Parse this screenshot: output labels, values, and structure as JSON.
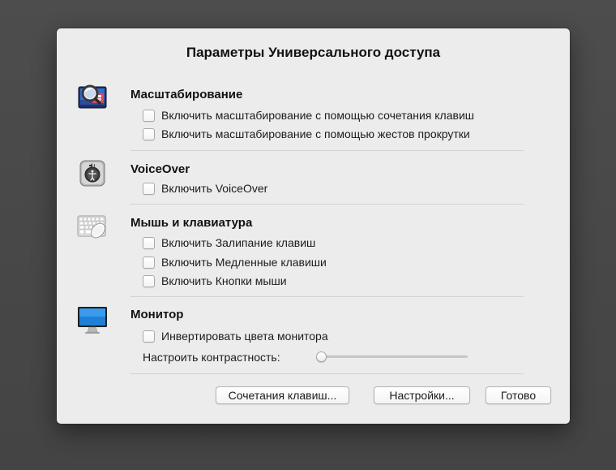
{
  "dialog": {
    "title": "Параметры Универсального доступа"
  },
  "sections": {
    "zoom": {
      "title": "Масштабирование",
      "icon": "zoom-magnifier-icon",
      "options": [
        "Включить масштабирование с помощью сочетания клавиш",
        "Включить масштабирование с помощью жестов прокрутки"
      ]
    },
    "voiceover": {
      "title": "VoiceOver",
      "icon": "voiceover-speaker-icon",
      "options": [
        "Включить VoiceOver"
      ]
    },
    "mouse_keyboard": {
      "title": "Мышь и клавиатура",
      "icon": "keyboard-mouse-icon",
      "options": [
        "Включить Залипание клавиш",
        "Включить Медленные клавиши",
        "Включить Кнопки мыши"
      ]
    },
    "monitor": {
      "title": "Монитор",
      "icon": "monitor-icon",
      "options": [
        "Инвертировать цвета монитора"
      ],
      "contrast_label": "Настроить контрастность:",
      "contrast_value": 0
    }
  },
  "buttons": {
    "shortcuts": "Сочетания клавиш...",
    "settings": "Настройки...",
    "done": "Готово"
  },
  "colors": {
    "backdrop": "#4a4a4a",
    "dialog_bg": "#ececec",
    "divider": "#d2d2d2"
  }
}
